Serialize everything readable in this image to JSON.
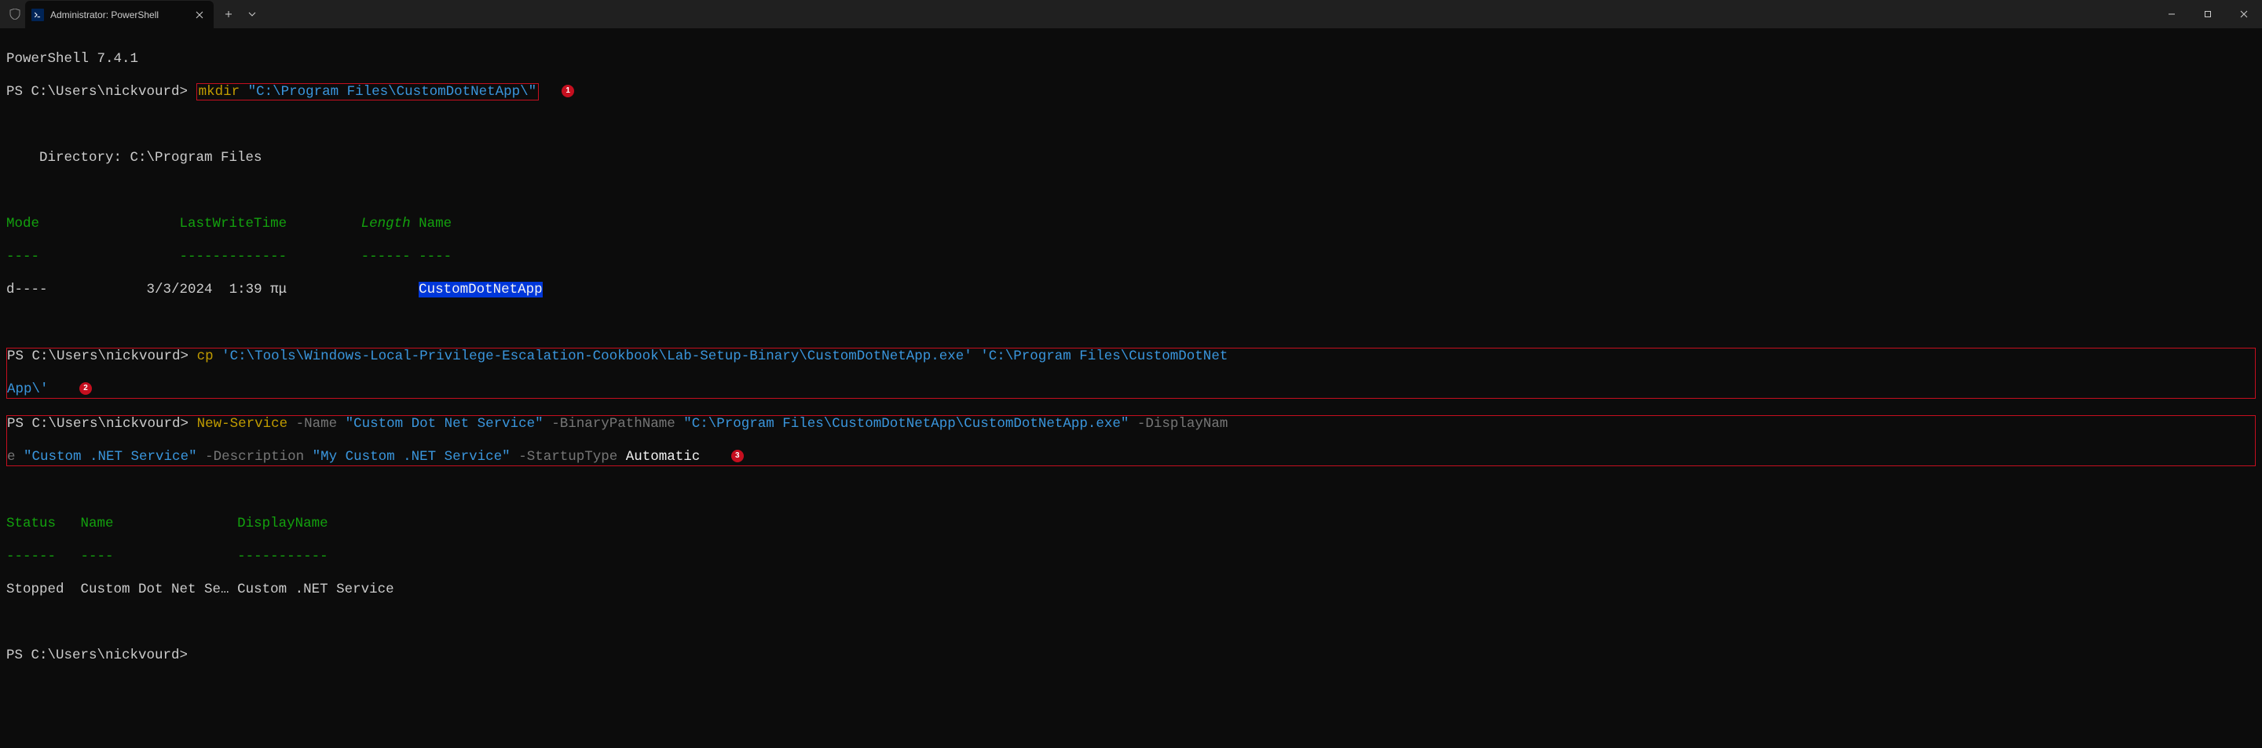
{
  "titlebar": {
    "tab_title": "Administrator: PowerShell"
  },
  "terminal": {
    "version": "PowerShell 7.4.1",
    "prompt": "PS C:\\Users\\nickvourd>",
    "cmd1": {
      "cmd": "mkdir",
      "arg": "\"C:\\Program Files\\CustomDotNetApp\\\""
    },
    "dir_header": "    Directory: C:\\Program Files",
    "columns": {
      "mode": "Mode",
      "lwt": "LastWriteTime",
      "length": "Length",
      "name": "Name"
    },
    "dash_mode": "----",
    "dash_lwt": "-------------",
    "dash_length": "------",
    "dash_name": "----",
    "row1": {
      "mode": "d----",
      "date": "3/3/2024",
      "time": "1:39 πμ",
      "name": "CustomDotNetApp"
    },
    "cmd2": {
      "cmd": "cp",
      "src": "'C:\\Tools\\Windows-Local-Privilege-Escalation-Cookbook\\Lab-Setup-Binary\\CustomDotNetApp.exe'",
      "dst_a": "'C:\\Program Files\\CustomDotNet",
      "dst_b": "App\\'"
    },
    "cmd3": {
      "cmd": "New-Service",
      "p_name": "-Name",
      "v_name": "\"Custom Dot Net Service\"",
      "p_bin": "-BinaryPathName",
      "v_bin": "\"C:\\Program Files\\CustomDotNetApp\\CustomDotNetApp.exe\"",
      "p_disp": "-DisplayNam",
      "p_disp2": "e",
      "v_disp": "\"Custom .NET Service\"",
      "p_desc": "-Description",
      "v_desc": "\"My Custom .NET Service\"",
      "p_start": "-StartupType",
      "v_start": "Automatic"
    },
    "svc_columns": {
      "status": "Status",
      "name": "Name",
      "disp": "DisplayName"
    },
    "dash_status": "------",
    "dash_sname": "----",
    "dash_disp": "-----------",
    "svc_row": {
      "status": "Stopped",
      "name": "Custom Dot Net Se…",
      "disp": "Custom .NET Service"
    },
    "annot1": "1",
    "annot2": "2",
    "annot3": "3"
  }
}
